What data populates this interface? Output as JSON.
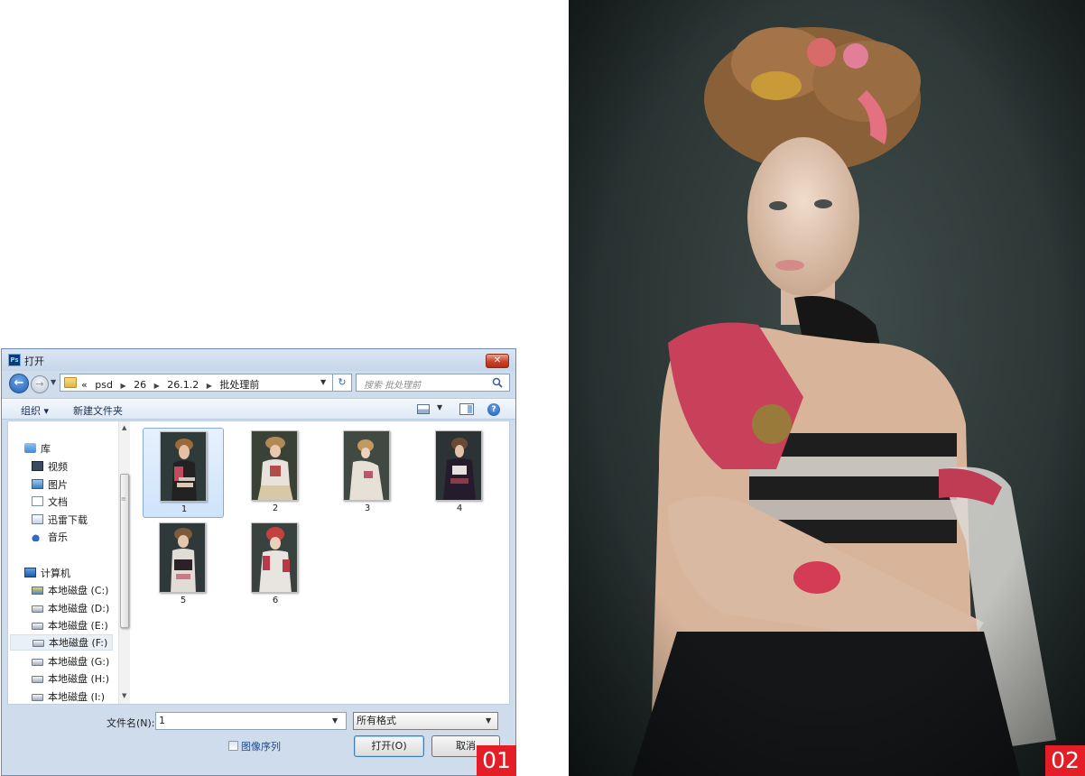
{
  "dialog": {
    "title": "打开",
    "app_icon": "photoshop-icon",
    "close_label": "✕",
    "breadcrumb": {
      "overflow": "«",
      "items": [
        "psd",
        "26",
        "26.1.2",
        "批处理前"
      ]
    },
    "search": {
      "placeholder": "搜索 批处理前"
    },
    "toolbar": {
      "organize_label": "组织 ▾",
      "new_folder_label": "新建文件夹"
    },
    "nav": {
      "library": "库",
      "library_items": [
        "视频",
        "图片",
        "文档",
        "迅雷下载",
        "音乐"
      ],
      "computer": "计算机",
      "drives": [
        "本地磁盘 (C:)",
        "本地磁盘 (D:)",
        "本地磁盘 (E:)",
        "本地磁盘 (F:)",
        "本地磁盘 (G:)",
        "本地磁盘 (H:)",
        "本地磁盘 (I:)"
      ],
      "selected_drive": "本地磁盘 (F:)"
    },
    "files": [
      "1",
      "2",
      "3",
      "4",
      "5",
      "6"
    ],
    "selected_file": "1",
    "footer": {
      "filename_label": "文件名(N):",
      "filename_value": "1",
      "filetype_value": "所有格式",
      "image_sequence_label": "图像序列",
      "open_label": "打开(O)",
      "cancel_label": "取消"
    }
  },
  "badges": {
    "left": "01",
    "right": "02"
  },
  "colors": {
    "badge_red": "#e41e26",
    "selection_blue": "#cfe3fb",
    "title_gradient": "#c7d6ea"
  }
}
